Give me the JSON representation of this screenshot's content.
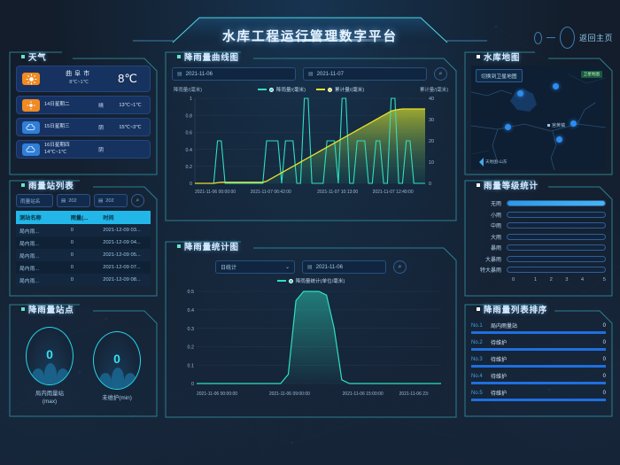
{
  "header": {
    "title": "水库工程运行管理数字平台",
    "home_label": "返回主页"
  },
  "weather": {
    "panel_title": "天气",
    "current": {
      "city": "曲阜市",
      "range": "8℃~1℃",
      "temp": "8℃",
      "icon": "sun-icon"
    },
    "forecast": [
      {
        "day": "14日星期二",
        "cond": "晴",
        "temp": "13℃~1℃",
        "icon": "sun-icon"
      },
      {
        "day": "15日星期三",
        "cond": "阴",
        "temp": "15℃~3℃",
        "icon": "cloud-icon"
      },
      {
        "day": "16日星期四\n14℃~1℃",
        "cond": "阴",
        "temp": "",
        "icon": "cloud-icon"
      }
    ]
  },
  "station_list": {
    "panel_title": "雨量站列表",
    "search_placeholder": "雨量站名",
    "date_start": "202",
    "date_end": "202",
    "search_icon": "search-icon",
    "columns": [
      "测站名称",
      "雨量(...",
      "时间"
    ],
    "rows": [
      {
        "name": "局内雨...",
        "value": "0",
        "time": "2021-12-09 03..."
      },
      {
        "name": "局内雨...",
        "value": "0",
        "time": "2021-12-09 04..."
      },
      {
        "name": "局内雨...",
        "value": "0",
        "time": "2021-12-09 05..."
      },
      {
        "name": "局内雨...",
        "value": "0",
        "time": "2021-12-09 07..."
      },
      {
        "name": "局内雨...",
        "value": "0",
        "time": "2021-12-09 08..."
      }
    ]
  },
  "gauges": {
    "panel_title": "降雨量站点",
    "items": [
      {
        "value": "0",
        "label": "局内雨量站\n(max)"
      },
      {
        "value": "0",
        "label": "未维护(min)"
      }
    ]
  },
  "curve": {
    "panel_title": "降雨量曲线图",
    "date_start": "2021-11-06",
    "date_end": "2021-11-07",
    "search_icon": "search-icon"
  },
  "stat": {
    "panel_title": "降雨量统计图",
    "period": "日统计",
    "date": "2021-11-06",
    "search_icon": "search-icon"
  },
  "map": {
    "panel_title": "水库地图",
    "toggle_label": "切换到卫星地图",
    "town_label": "宫黄镇",
    "badge": "卫星地图",
    "logo_text": "天地图·山东"
  },
  "grade": {
    "panel_title": "雨量等级统计"
  },
  "rank": {
    "panel_title": "降雨量列表排序",
    "items": [
      {
        "no": "No.1",
        "name": "局内雨量站",
        "value": "0"
      },
      {
        "no": "No.2",
        "name": "待维护",
        "value": "0"
      },
      {
        "no": "No.3",
        "name": "待维护",
        "value": "0"
      },
      {
        "no": "No.4",
        "name": "待维护",
        "value": "0"
      },
      {
        "no": "No.5",
        "name": "待维护",
        "value": "0"
      }
    ]
  },
  "colors": {
    "accent_cyan": "#2fe0c0",
    "accent_yellow": "#e8e22a",
    "accent_blue": "#2d8cf0",
    "panel_border": "#2c7f8f",
    "bg": "#131d2b"
  },
  "chart_data": [
    {
      "type": "line",
      "title": "降雨量曲线图",
      "ylabel": "降雨量/(毫米)",
      "y2label": "累计量/(毫米)",
      "xlabel": "",
      "ylim": [
        0,
        1
      ],
      "y2lim": [
        0,
        40
      ],
      "yticks": [
        "0",
        "0.2",
        "0.4",
        "0.6",
        "0.8",
        "1"
      ],
      "y2ticks": [
        "0",
        "10",
        "20",
        "30",
        "40"
      ],
      "xticks": [
        "2021-11-06 00:00:00",
        "2021-11-07 06:42:00",
        "2021-11-07 10:13:00",
        "2021-11-07 12:49:00"
      ],
      "grid": true,
      "legend_position": "top-center",
      "series": [
        {
          "name": "降雨量/(毫米)",
          "color": "#2fe0c0",
          "values": [
            0,
            0,
            0,
            0,
            0,
            0,
            0.5,
            0.5,
            0,
            0,
            0,
            0,
            0,
            0,
            0,
            0,
            0,
            0,
            0,
            0.5,
            0.5,
            0.5,
            0.5,
            0,
            0.5,
            0.5,
            0.5,
            0,
            0,
            1,
            1,
            0,
            0,
            0,
            0,
            0.5,
            0.5,
            0.5,
            0,
            1,
            1,
            0,
            0,
            0.5,
            0.5,
            0.5,
            0,
            0,
            0.5,
            0.5,
            0,
            0,
            1,
            1,
            0,
            0,
            0.5,
            0.5,
            0,
            0,
            0,
            0
          ]
        },
        {
          "name": "累计量/(毫米)",
          "color": "#e8e22a",
          "axis": "right",
          "values": [
            0,
            0,
            0,
            0,
            0,
            0,
            0.3,
            0.5,
            0.5,
            0.5,
            0.5,
            0.5,
            0.5,
            0.5,
            0.5,
            0.5,
            0.5,
            0.5,
            0.5,
            1,
            2,
            3,
            4,
            5,
            6,
            7,
            8,
            9,
            10,
            11,
            12,
            13,
            14,
            15,
            16,
            17,
            18,
            19,
            20,
            21,
            22,
            23,
            24,
            25,
            26,
            27,
            28,
            29,
            30,
            31,
            32,
            33,
            34,
            34.5,
            34.8,
            35,
            35,
            35,
            35,
            35,
            35,
            35
          ]
        }
      ]
    },
    {
      "type": "line",
      "title": "降雨量统计图",
      "ylabel": "",
      "legend": [
        "降雨量统计(单位/毫米)"
      ],
      "legend_position": "top-center",
      "ylim": [
        0,
        0.5
      ],
      "yticks": [
        "0",
        "0.1",
        "0.2",
        "0.3",
        "0.4",
        "0.5"
      ],
      "xticks": [
        "2021-11-06 00:00:00",
        "2021-11-06 09:00:00",
        "2021-11-06 15:00:00",
        "2021-11-06 23:"
      ],
      "grid": true,
      "series": [
        {
          "name": "降雨量统计(单位/毫米)",
          "color": "#2fe0c0",
          "values": [
            0,
            0,
            0,
            0,
            0,
            0,
            0,
            0,
            0,
            0,
            0,
            0,
            0.05,
            0.45,
            0.5,
            0.5,
            0.5,
            0.48,
            0.3,
            0.02,
            0,
            0,
            0,
            0,
            0,
            0,
            0,
            0,
            0,
            0,
            0,
            0,
            0
          ]
        }
      ]
    },
    {
      "type": "bar",
      "title": "雨量等级统计",
      "orientation": "horizontal",
      "categories": [
        "无雨",
        "小雨",
        "中雨",
        "大雨",
        "暴雨",
        "大暴雨",
        "特大暴雨"
      ],
      "values": [
        5,
        0,
        0,
        0,
        0,
        0,
        0
      ],
      "xlim": [
        0,
        5
      ],
      "xticks": [
        "0",
        "1",
        "2",
        "3",
        "4",
        "5"
      ],
      "color": "#2d8cf0"
    }
  ]
}
